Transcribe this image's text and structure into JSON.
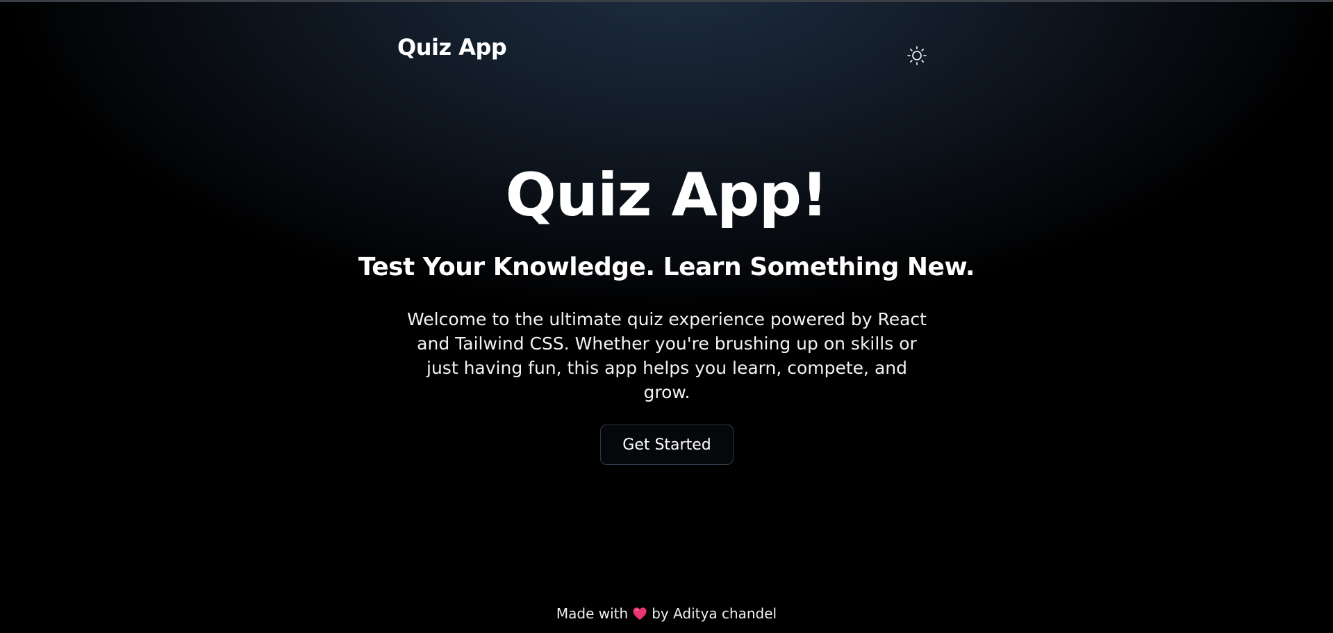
{
  "navbar": {
    "brand": "Quiz App",
    "theme_toggle_icon": "sun-icon"
  },
  "hero": {
    "title": "Quiz App!",
    "subtitle": "Test Your Knowledge. Learn Something New.",
    "description": "Welcome to the ultimate quiz experience powered by React and Tailwind CSS. Whether you're brushing up on skills or just having fun, this app helps you learn, compete, and grow.",
    "cta_label": "Get Started"
  },
  "footer": {
    "prefix": "Made with",
    "heart_icon": "heart-icon",
    "suffix": "by Aditya chandel"
  },
  "colors": {
    "background": "#000000",
    "background_glow": "#1e2d3f",
    "text": "#ffffff",
    "button_border": "#2f3a48",
    "heart": "#e8356d"
  }
}
